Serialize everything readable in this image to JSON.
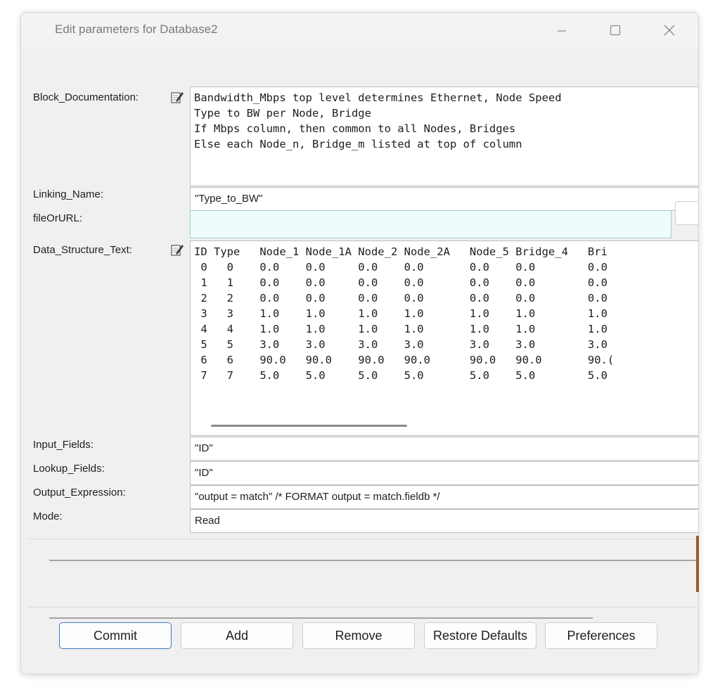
{
  "window": {
    "title": "Edit parameters for Database2"
  },
  "fields": {
    "block_documentation": {
      "label": "Block_Documentation:",
      "value": "Bandwidth_Mbps top level determines Ethernet, Node Speed\nType to BW per Node, Bridge\nIf Mbps column, then common to all Nodes, Bridges\nElse each Node_n, Bridge_m listed at top of column"
    },
    "linking_name": {
      "label": "Linking_Name:",
      "value": "\"Type_to_BW\""
    },
    "file_or_url": {
      "label": "fileOrURL:",
      "value": ""
    },
    "data_structure_text": {
      "label": "Data_Structure_Text:",
      "value": "ID Type   Node_1 Node_1A Node_2 Node_2A   Node_5 Bridge_4   Bri\n 0   0    0.0    0.0     0.0    0.0       0.0    0.0        0.0\n 1   1    0.0    0.0     0.0    0.0       0.0    0.0        0.0\n 2   2    0.0    0.0     0.0    0.0       0.0    0.0        0.0\n 3   3    1.0    1.0     1.0    1.0       1.0    1.0        1.0\n 4   4    1.0    1.0     1.0    1.0       1.0    1.0        1.0\n 5   5    3.0    3.0     3.0    3.0       3.0    3.0        3.0\n 6   6    90.0   90.0    90.0   90.0      90.0   90.0       90.(\n 7   7    5.0    5.0     5.0    5.0       5.0    5.0        5.0"
    },
    "input_fields": {
      "label": "Input_Fields:",
      "value": "\"ID\""
    },
    "lookup_fields": {
      "label": "Lookup_Fields:",
      "value": "\"ID\""
    },
    "output_expression": {
      "label": "Output_Expression:",
      "value": "\"output = match\" /* FORMAT output = match.fieldb */"
    },
    "mode": {
      "label": "Mode:",
      "value": "Read"
    }
  },
  "buttons": {
    "commit": "Commit",
    "add": "Add",
    "remove": "Remove",
    "restore_defaults": "Restore Defaults",
    "preferences": "Preferences"
  },
  "icons": {
    "minimize": "minimize-icon",
    "maximize": "maximize-icon",
    "close": "close-icon",
    "edit": "edit-pencil-icon"
  },
  "colors": {
    "primary_button_border": "#3f78c3",
    "url_field_bg": "#eefcfd"
  }
}
